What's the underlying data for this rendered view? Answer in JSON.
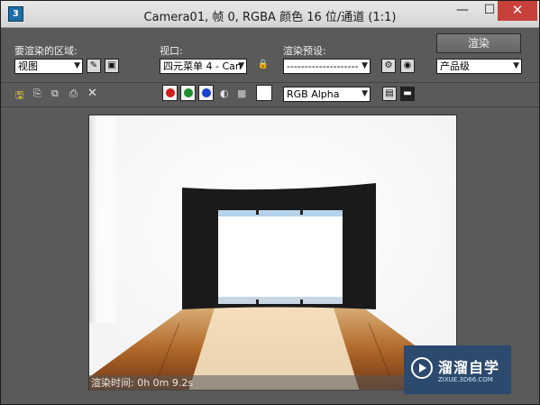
{
  "window": {
    "title": "Camera01, 帧 0, RGBA 颜色 16 位/通道 (1:1)",
    "app_icon": "3ds-max-icon",
    "min_label": "—",
    "max_label": "☐",
    "close_label": "✕"
  },
  "panel": {
    "area_label": "要渲染的区域:",
    "area_value": "视图",
    "viewport_label": "视口:",
    "viewport_value": "四元菜单 4 - Can",
    "preset_label": "渲染预设:",
    "preset_value": "--------------------",
    "render_button": "渲染",
    "quality_value": "产品级"
  },
  "toolbar": {
    "channel_value": "RGB Alpha",
    "colors": {
      "red": "#cc1f1f",
      "green": "#1a8f2a",
      "blue": "#1d3fcf"
    }
  },
  "render": {
    "status": "渲染时间: 0h 0m 9.2s"
  },
  "watermark": {
    "title": "溜溜自学",
    "subtitle": "ZIXUE.3D66.COM"
  }
}
